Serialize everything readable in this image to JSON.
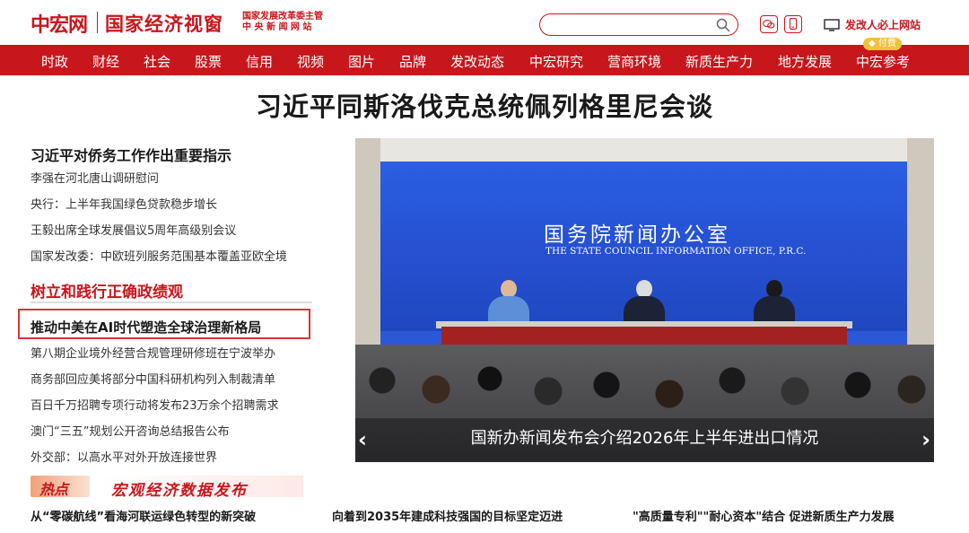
{
  "header": {
    "logo": "中宏网",
    "title": "国家经济视窗",
    "sub_line1": "国家发展改革委主管",
    "sub_line2": "中 央 新 闻 网 站",
    "search_placeholder": "",
    "site_link": "发改人必上网站"
  },
  "nav": {
    "items": [
      "时政",
      "财经",
      "社会",
      "股票",
      "信用",
      "视频",
      "图片",
      "品牌",
      "发改动态",
      "中宏研究",
      "营商环境",
      "新质生产力",
      "地方发展",
      "中宏参考"
    ],
    "badge": "付费"
  },
  "headline": "习近平同斯洛伐克总统佩列格里尼会谈",
  "left": {
    "lead": "习近平对侨务工作作出重要指示",
    "items1": [
      "李强在河北唐山调研慰问",
      "央行：上半年我国绿色贷款稳步增长",
      "王毅出席全球发展倡议5周年高级别会议",
      "国家发改委：中欧班列服务范围基本覆盖亚欧全境"
    ],
    "section_title": "树立和践行正确政绩观",
    "highlight": "推动中美在AI时代塑造全球治理新格局",
    "items2": [
      "第八期企业境外经营合规管理研修班在宁波举办",
      "商务部回应美将部分中国科研机构列入制裁清单",
      "百日千万招聘专项行动将发布23万余个招聘需求",
      "澳门“三五”规划公开咨询总结报告公布",
      "外交部：以高水平对外开放连接世界"
    ]
  },
  "photo": {
    "banner_cn": "国务院新闻办公室",
    "banner_en": "THE STATE COUNCIL INFORMATION OFFICE, P.R.C.",
    "caption": "国新办新闻发布会介绍2026年上半年进出口情况",
    "prev": "‹",
    "next": "›"
  },
  "hot": {
    "tag": "热点",
    "macro": "宏观经济数据发布",
    "links": [
      "从“零碳航线”看海河联运绿色转型的新突破",
      "向着到2035年建成科技强国的目标坚定迈进",
      "\"高质量专利\"\"耐心资本\"结合 促进新质生产力发展"
    ]
  },
  "colors": {
    "brand": "#c8161d",
    "highlight_border": "#d8343b"
  }
}
